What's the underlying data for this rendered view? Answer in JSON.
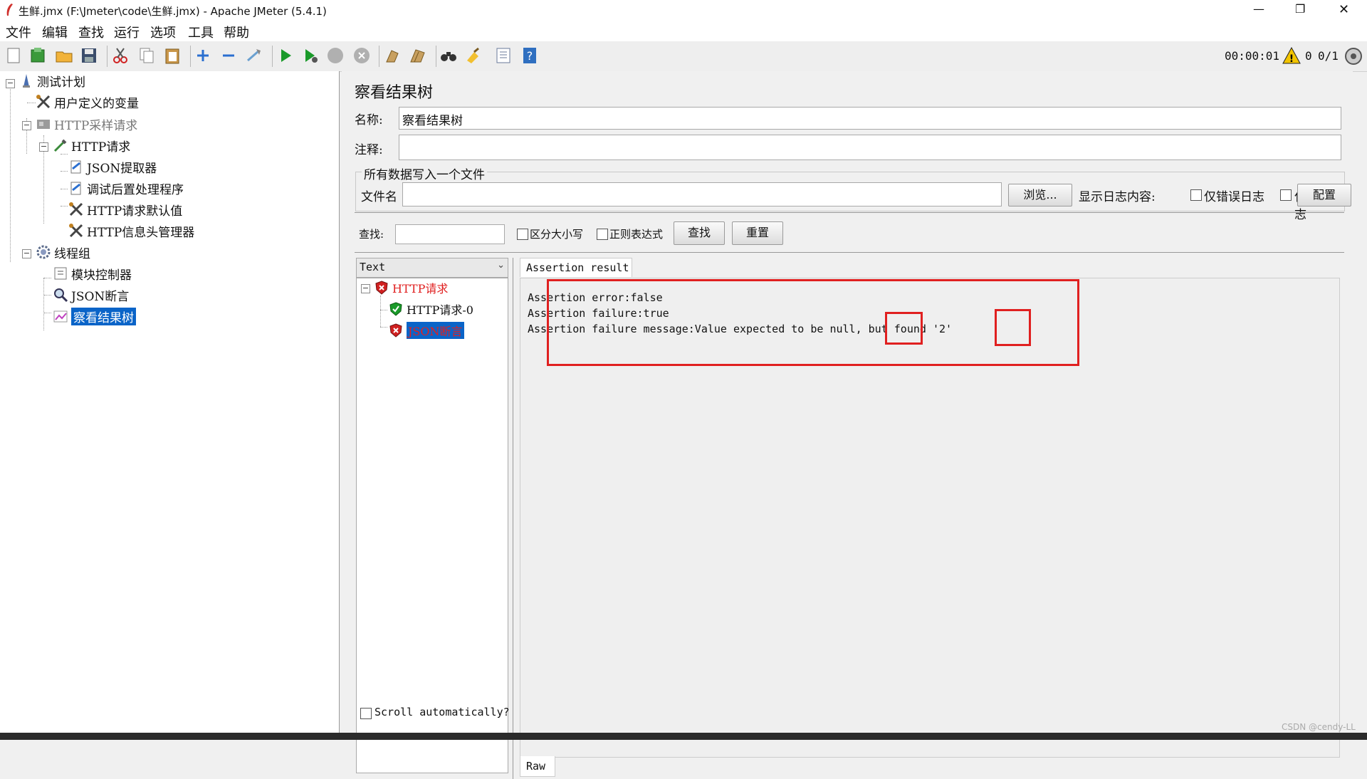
{
  "window": {
    "title": "生鲜.jmx (F:\\Jmeter\\code\\生鲜.jmx) - Apache JMeter (5.4.1)",
    "controls": [
      "—",
      "❐",
      "✕"
    ]
  },
  "menu": [
    "文件",
    "编辑",
    "查找",
    "运行",
    "选项",
    "工具",
    "帮助"
  ],
  "toolbar": {
    "elapsed": "00:00:01",
    "warning_count": "0",
    "threads": "0/1"
  },
  "tree": {
    "items": [
      {
        "label": "测试计划"
      },
      {
        "label": "用户定义的变量"
      },
      {
        "label": "HTTP采样请求"
      },
      {
        "label": "HTTP请求"
      },
      {
        "label": "JSON提取器"
      },
      {
        "label": "调试后置处理程序"
      },
      {
        "label": "HTTP请求默认值"
      },
      {
        "label": "HTTP信息头管理器"
      },
      {
        "label": "线程组"
      },
      {
        "label": "模块控制器"
      },
      {
        "label": "JSON断言"
      },
      {
        "label": "察看结果树"
      }
    ]
  },
  "panel": {
    "title": "察看结果树",
    "name_label": "名称:",
    "name_value": "察看结果树",
    "comment_label": "注释:",
    "comment_value": "",
    "file_group_title": "所有数据写入一个文件",
    "filename_label": "文件名",
    "filename_value": "",
    "browse_button": "浏览...",
    "log_label": "显示日志内容:",
    "errors_only": "仅错误日志",
    "success_only": "仅成功日志",
    "config_button": "配置"
  },
  "search": {
    "label": "查找:",
    "value": "",
    "case_sensitive": "区分大小写",
    "regex": "正则表达式",
    "find_button": "查找",
    "reset_button": "重置"
  },
  "results": {
    "renderer": "Text",
    "items": [
      {
        "label": "HTTP请求",
        "status": "fail"
      },
      {
        "label": "HTTP请求-0",
        "status": "pass"
      },
      {
        "label": "JSON断言",
        "status": "fail"
      }
    ],
    "scroll_auto": "Scroll automatically?",
    "tab": "Assertion result",
    "raw_tab": "Raw",
    "lines": [
      "Assertion error:false",
      "Assertion failure:true",
      "Assertion failure message:Value expected to be null, but found '2'"
    ]
  },
  "watermark": "CSDN @cendy-LL",
  "colors": {
    "accent": "#0a64c8",
    "fail": "#e02020",
    "pass": "#1a9a2a"
  }
}
